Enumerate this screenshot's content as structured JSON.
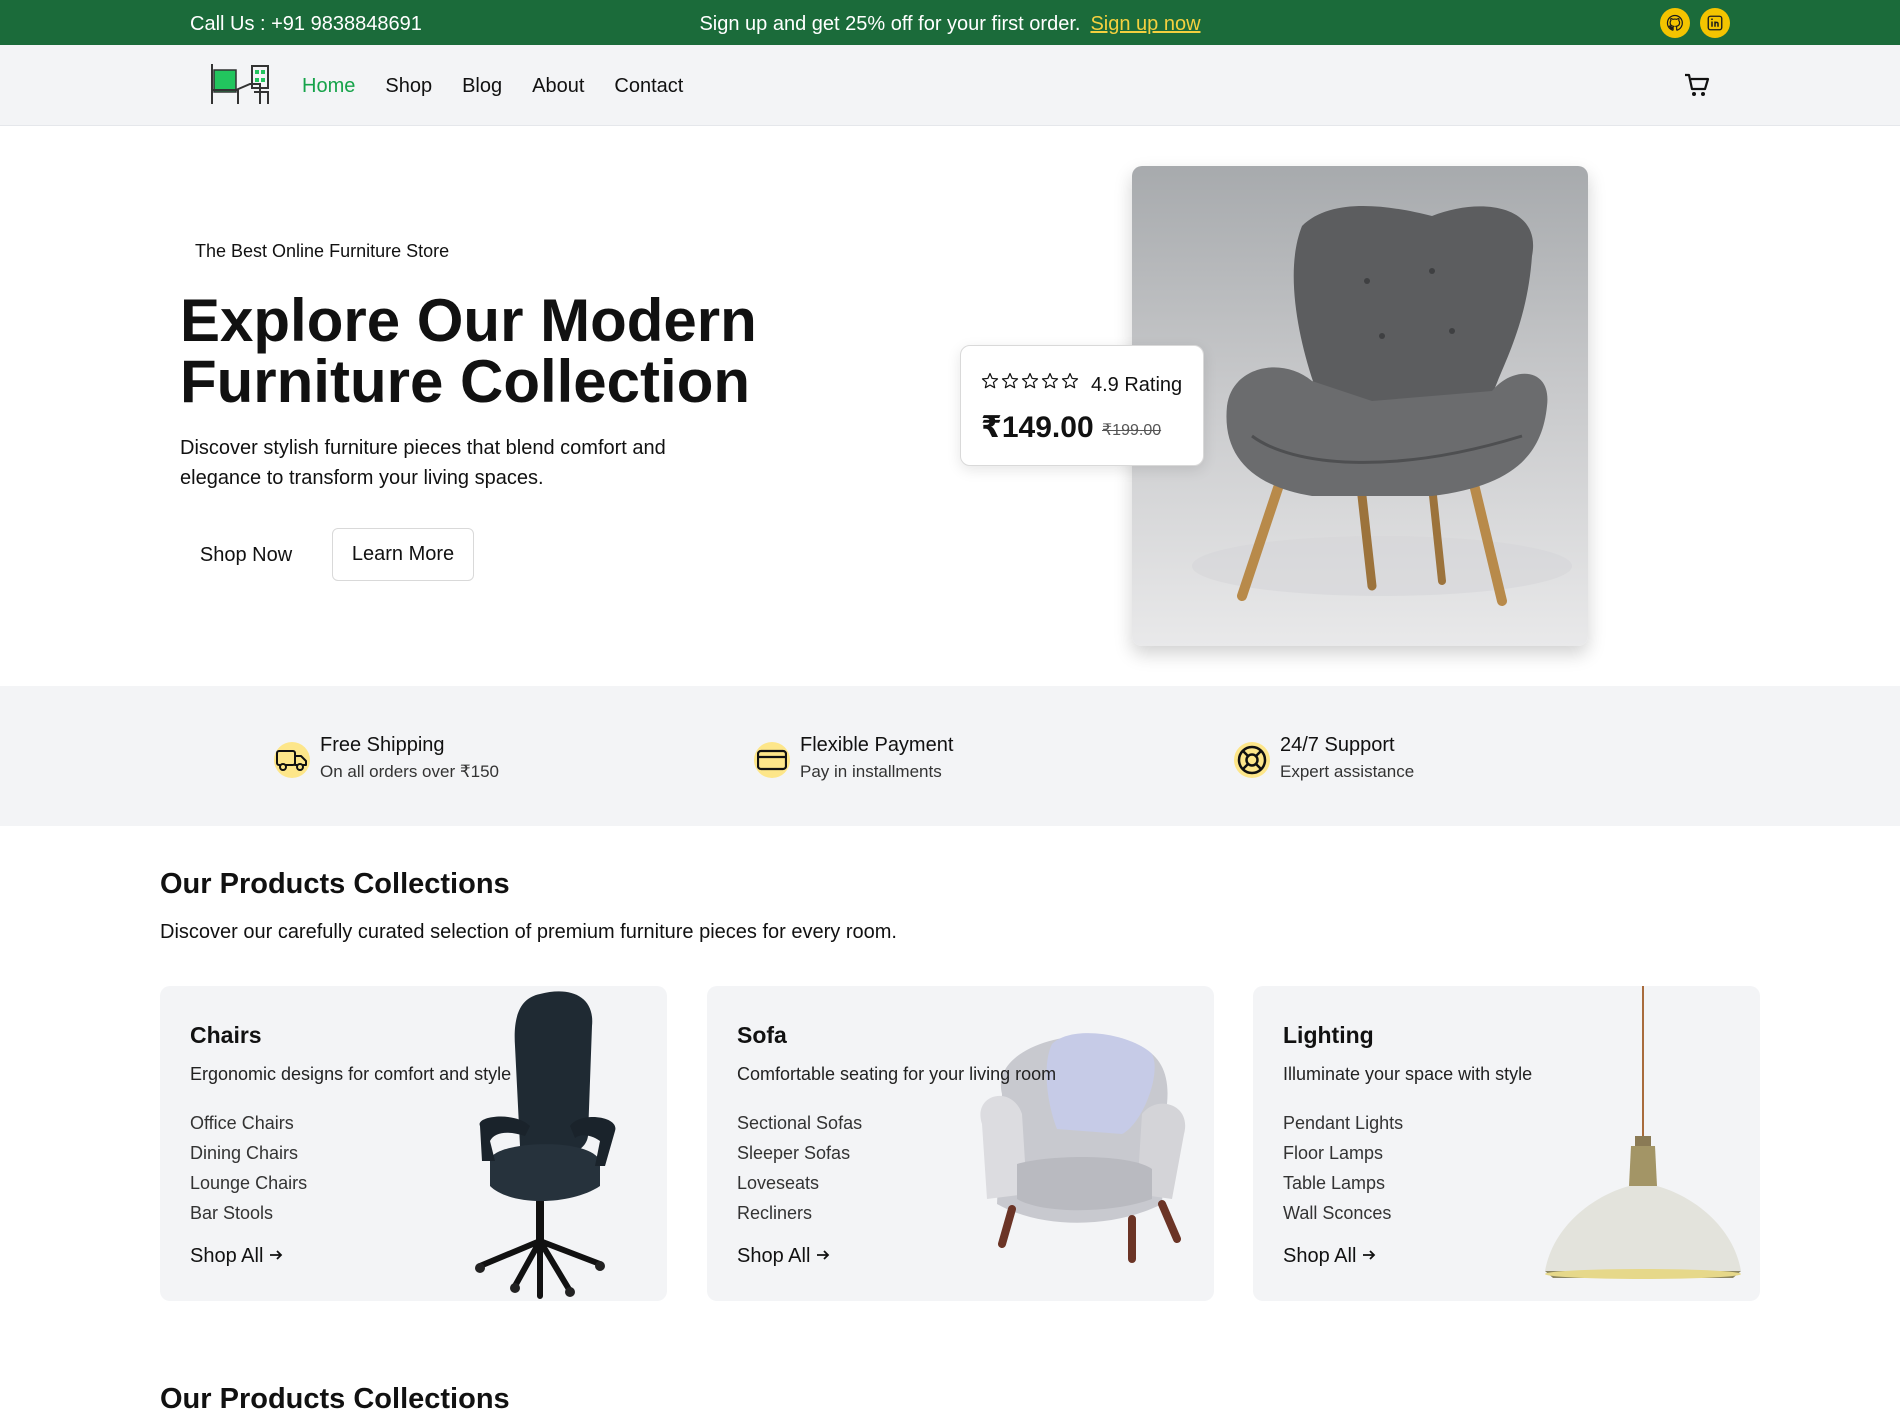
{
  "topbar": {
    "call": "Call Us : +91 9838848691",
    "promo_text": "Sign up and get 25% off for your first order.",
    "promo_link": "Sign up now",
    "social": [
      {
        "icon": "github-icon"
      },
      {
        "icon": "linkedin-icon"
      }
    ]
  },
  "nav": {
    "links": [
      "Home",
      "Shop",
      "Blog",
      "About",
      "Contact"
    ],
    "active": "Home",
    "cart_icon": "cart-icon"
  },
  "hero": {
    "subtitle": "The Best Online Furniture Store",
    "title": "Explore Our Modern Furniture Collection",
    "description": "Discover stylish furniture pieces that blend comfort and elegance to transform your living spaces.",
    "primary_button": "Shop Now",
    "secondary_button": "Learn More",
    "rating_text": "4.9 Rating",
    "stars": 5,
    "price": "₹149.00",
    "old_price": "₹199.00"
  },
  "features": [
    {
      "title": "Free Shipping",
      "desc": "On all orders over ₹150",
      "icon": "truck-icon"
    },
    {
      "title": "Flexible Payment",
      "desc": "Pay in installments",
      "icon": "credit-card-icon"
    },
    {
      "title": "24/7 Support",
      "desc": "Expert assistance",
      "icon": "lifebuoy-icon"
    }
  ],
  "collections": {
    "title": "Our Products Collections",
    "description": "Discover our carefully curated selection of premium furniture pieces for every room.",
    "cards": [
      {
        "title": "Chairs",
        "desc": "Ergonomic designs for comfort and style",
        "items": [
          "Office Chairs",
          "Dining Chairs",
          "Lounge Chairs",
          "Bar Stools"
        ],
        "link": "Shop All"
      },
      {
        "title": "Sofa",
        "desc": "Comfortable seating for your living room",
        "items": [
          "Sectional Sofas",
          "Sleeper Sofas",
          "Loveseats",
          "Recliners"
        ],
        "link": "Shop All"
      },
      {
        "title": "Lighting",
        "desc": "Illuminate your space with style",
        "items": [
          "Pendant Lights",
          "Floor Lamps",
          "Table Lamps",
          "Wall Sconces"
        ],
        "link": "Shop All"
      }
    ]
  },
  "collections_repeat_title": "Our Products Collections",
  "colors": {
    "topbar": "#1b6b3a",
    "accent_green": "#16a34a",
    "social_yellow": "#f4c400",
    "icon_bg": "#fde68a",
    "section_bg": "#f3f4f6"
  }
}
